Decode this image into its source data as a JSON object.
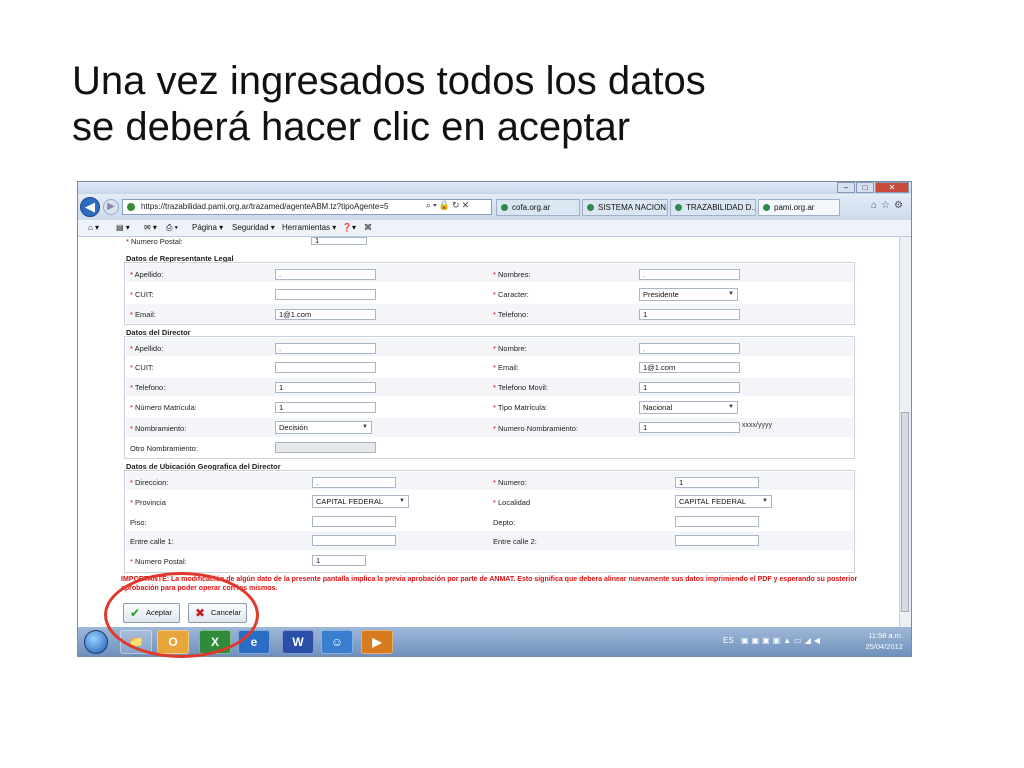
{
  "slide": {
    "line1": "Una vez ingresados todos los datos",
    "line2": "se deberá hacer clic en aceptar"
  },
  "browser": {
    "url": "https://trazabilidad.pami.org.ar/trazamed/agenteABM.tz?tipoAgente=5",
    "tabs": [
      "cofa.org.ar",
      "SISTEMA NACION...",
      "TRAZABILIDAD D...",
      "pami.org.ar"
    ],
    "menu": [
      "Página ▾",
      "Seguridad ▾",
      "Herramientas ▾"
    ]
  },
  "form": {
    "top_partial": {
      "label": "Numero Postal:",
      "value": "1"
    },
    "rep_title": "Datos de Representante Legal",
    "rep": {
      "apellido_label": "Apellido:",
      "apellido_value": ".",
      "nombres_label": "Nombres:",
      "nombres_value": ".",
      "cuit_label": "CUIT:",
      "cuit_value": "",
      "caracter_label": "Caracter:",
      "caracter_value": "Presidente",
      "email_label": "Email:",
      "email_value": "1@1.com",
      "telefono_label": "Telefono:",
      "telefono_value": "1"
    },
    "dir_title": "Datos del Director",
    "dir": {
      "apellido_label": "Apellido:",
      "apellido_value": ".",
      "nombre_label": "Nombre:",
      "nombre_value": ".",
      "cuit_label": "CUIT:",
      "cuit_value": "",
      "email_label": "Email:",
      "email_value": "1@1.com",
      "telefono_label": "Telefono:",
      "telefono_value": "1",
      "movil_label": "Telefono Movil:",
      "movil_value": "1",
      "matricula_label": "Número Matrícula:",
      "matricula_value": "1",
      "tipo_label": "Tipo Matrícula:",
      "tipo_value": "Nacional",
      "nombramiento_label": "Nombramiento:",
      "nombramiento_value": "Decisión",
      "numnomb_label": "Numero Nombramiento:",
      "numnomb_value": "1",
      "numnomb_hint": "xxxx/yyyy",
      "otro_label": "Otro Nombramiento:"
    },
    "ubic_title": "Datos de Ubicación Geografica del Director",
    "ubic": {
      "direccion_label": "Direccion:",
      "direccion_value": ".",
      "numero_label": "Numero:",
      "numero_value": "1",
      "provincia_label": "Provincia",
      "provincia_value": "CAPITAL FEDERAL",
      "localidad_label": "Localidad",
      "localidad_value": "CAPITAL FEDERAL",
      "piso_label": "Piso:",
      "depto_label": "Depto:",
      "calle1_label": "Entre calle 1:",
      "calle2_label": "Entre calle 2:",
      "postal_label": "Numero Postal:",
      "postal_value": "1"
    },
    "warning": "IMPORTANTE: La modificación de algún dato de la presente pantalla implica la previa aprobación por parte de ANMAT. Esto significa que debera alinear nuevamente sus datos imprimiendo el PDF y esperando su posterior aprobación para poder operar con los mismos.",
    "accept_label": "Aceptar",
    "cancel_label": "Cancelar"
  },
  "taskbar": {
    "lang": "ES",
    "time": "11:58 a.m.",
    "date": "25/04/2012"
  },
  "colors": {
    "highlight": "#e0392b",
    "required": "#cc0000",
    "warning": "#dd1111"
  }
}
